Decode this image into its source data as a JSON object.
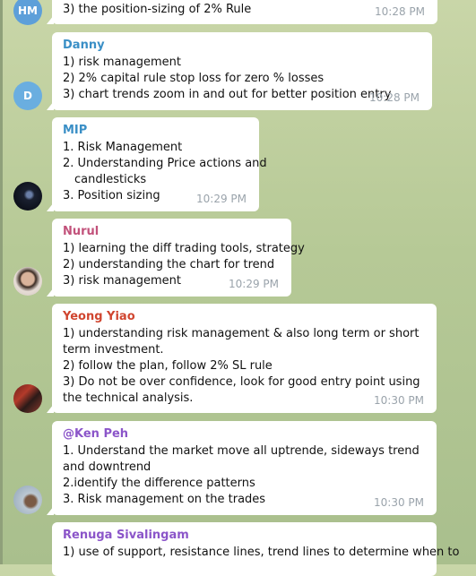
{
  "chat": {
    "messages": [
      {
        "avatar_initials": "HM",
        "avatar_color": "#5d9fd9",
        "sender": "",
        "lines": [
          "3) the position-sizing of 2% Rule"
        ],
        "time": "10:28 PM"
      },
      {
        "avatar_initials": "D",
        "avatar_color": "#6aaee0",
        "sender": "Danny",
        "sender_color": "#3a8fc6",
        "lines": [
          "1) risk management",
          "2) 2% capital rule stop loss for zero % losses",
          "3) chart trends zoom in and out for better position entry"
        ],
        "time": "10:28 PM"
      },
      {
        "avatar_icon": "space-photo-avatar",
        "sender": "MIP",
        "sender_color": "#3a8fc6",
        "lines": [
          "1. Risk Management",
          "2. Understanding Price actions and",
          "candlesticks",
          "3. Position sizing"
        ],
        "time": "10:29 PM"
      },
      {
        "avatar_icon": "woman-photo-avatar",
        "sender": "Nurul",
        "sender_color": "#c2527b",
        "lines": [
          "1) learning the diff trading tools, strategy",
          "2) understanding the chart for trend",
          "3) risk management"
        ],
        "time": "10:29 PM"
      },
      {
        "avatar_icon": "group-photo-avatar",
        "sender": "Yeong Yiao",
        "sender_color": "#d0452f",
        "lines": [
          "1) understanding risk management & also long term or short term investment.",
          "2) follow the plan, follow 2% SL rule",
          "3) Do not be over confidence, look for good entry point using the technical analysis."
        ],
        "time": "10:30 PM"
      },
      {
        "avatar_icon": "man-photo-avatar",
        "sender": "@Ken Peh",
        "sender_color": "#8b55c9",
        "lines": [
          "1. Understand the market move all uptrende, sideways trend and downtrend",
          "2.identify the difference patterns",
          "3. Risk management on the trades"
        ],
        "time": "10:30 PM"
      },
      {
        "sender": "Renuga Sivalingam",
        "sender_color": "#8b55c9",
        "lines": [
          "1) use of support, resistance lines, trend lines to determine when to"
        ]
      }
    ]
  }
}
